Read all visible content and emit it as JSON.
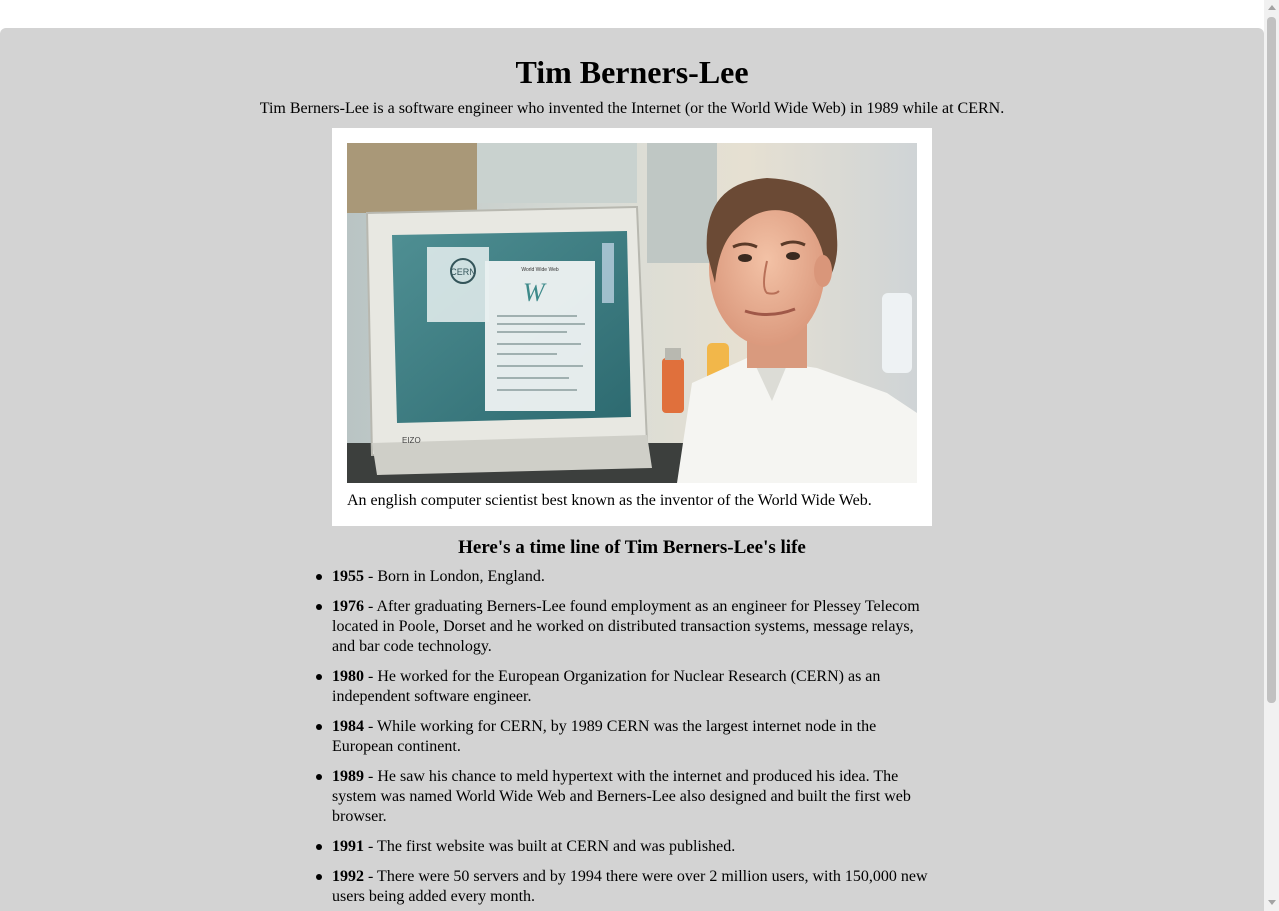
{
  "page": {
    "title": "Tim Berners-Lee",
    "intro": "Tim Berners-Lee is a software engineer who invented the Internet (or the World Wide Web) in 1989 while at CERN."
  },
  "figure": {
    "caption": "An english computer scientist best known as the inventor of the World Wide Web.",
    "screen_logo": "CERN",
    "screen_heading": "World Wide Web",
    "monitor_brand": "EIZO"
  },
  "timeline": {
    "heading": "Here's a time line of Tim Berners-Lee's life",
    "items": [
      {
        "year": "1955",
        "text": " - Born in London, England."
      },
      {
        "year": "1976",
        "text": " - After graduating Berners-Lee found employment as an engineer for Plessey Telecom located in Poole, Dorset and he worked on distributed transaction systems, message relays, and bar code technology."
      },
      {
        "year": "1980",
        "text": " - He worked for the European Organization for Nuclear Research (CERN) as an independent software engineer."
      },
      {
        "year": "1984",
        "text": " - While working for CERN, by 1989 CERN was the largest internet node in the European continent."
      },
      {
        "year": "1989",
        "text": " - He saw his chance to meld hypertext with the internet and produced his idea. The system was named World Wide Web and Berners-Lee also designed and built the first web browser."
      },
      {
        "year": "1991",
        "text": " - The first website was built at CERN and was published."
      },
      {
        "year": "1992",
        "text": " - There were 50 servers and by 1994 there were over 2 million users, with 150,000 new users being added every month."
      }
    ]
  },
  "colors": {
    "page_background": "#d3d3d3",
    "figure_background": "#ffffff",
    "scrollbar_track": "#f1f1f1",
    "scrollbar_thumb": "#c1c1c1"
  }
}
